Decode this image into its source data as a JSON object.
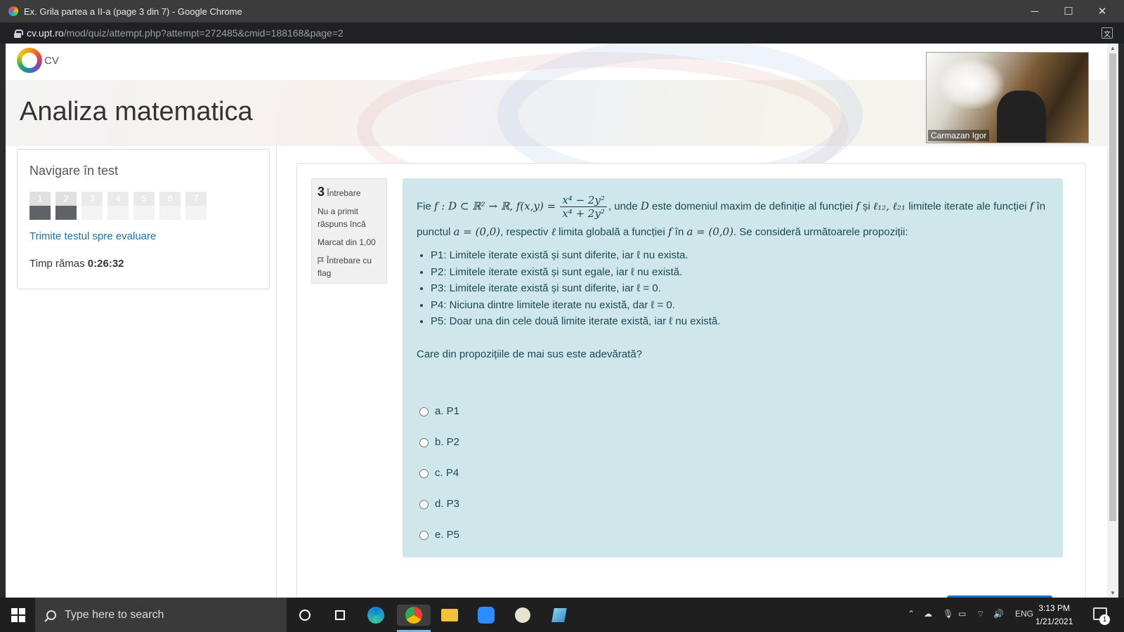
{
  "window": {
    "title": "Ex. Grila partea a II-a (page 3 din 7) - Google Chrome",
    "minimize": "─",
    "maximize": "☐",
    "close": "✕"
  },
  "address": {
    "host": "cv.upt.ro",
    "path": "/mod/quiz/attempt.php?attempt=272485&cmid=188168&page=2",
    "translate_glyph": "文"
  },
  "site": {
    "logo_text": "CV",
    "page_title": "Analiza matematica"
  },
  "video": {
    "participant_name": "Carmazan Igor"
  },
  "quiz_nav": {
    "title": "Navigare în test",
    "questions": [
      {
        "number": "1",
        "answered": true
      },
      {
        "number": "2",
        "answered": true
      },
      {
        "number": "3",
        "answered": false
      },
      {
        "number": "4",
        "answered": false
      },
      {
        "number": "5",
        "answered": false
      },
      {
        "number": "6",
        "answered": false
      },
      {
        "number": "7",
        "answered": false
      }
    ],
    "submit_link": "Trimite testul spre evaluare",
    "time_label": "Timp rămas",
    "time_value": "0:26:32"
  },
  "question_info": {
    "number": "3",
    "word": "Întrebare",
    "status": "Nu a primit răspuns încă",
    "marks": "Marcat din 1,00",
    "flag": "Întrebare cu flag"
  },
  "question": {
    "intro_1": "Fie",
    "math_f_def": "f : D ⊂ ℝ² → ℝ, f(x,y) =",
    "frac_num": "x⁴ − 2y²",
    "frac_den": "x⁴ + 2y²",
    "intro_2": ", unde",
    "math_D": "D",
    "intro_3": "este domeniul maxim de definiție al funcției",
    "math_f": "f",
    "intro_4": "și",
    "math_l12": "ℓ₁₂, ℓ₂₁",
    "intro_5": "limitele iterate ale funcției",
    "math_f2": "f",
    "intro_6": "în punctul",
    "math_a": "a = (0,0)",
    "intro_7": ", respectiv",
    "math_l": "ℓ",
    "intro_8": "limita globală a funcției",
    "math_f3": "f",
    "intro_9": "în",
    "math_a2": "a = (0,0)",
    "intro_10": ". Se consideră următoarele propoziții:",
    "propositions": [
      "P1: Limitele iterate există și sunt diferite, iar ℓ nu exista.",
      "P2: Limitele iterate există și sunt egale, iar ℓ nu există.",
      "P3: Limitele iterate există și sunt diferite, iar ℓ = 0.",
      "P4: Niciuna dintre limitele iterate nu există, dar ℓ = 0.",
      "P5: Doar una din cele două limite iterate există, iar ℓ nu există."
    ],
    "prompt": "Care din propozițiile de mai sus este adevărată?",
    "answers": [
      "a. P1",
      "b. P2",
      "c. P4",
      "d. P3",
      "e. P5"
    ]
  },
  "taskbar": {
    "search_placeholder": "Type here to search",
    "language": "ENG",
    "time": "3:13 PM",
    "date": "1/21/2021",
    "notification_count": "1"
  }
}
